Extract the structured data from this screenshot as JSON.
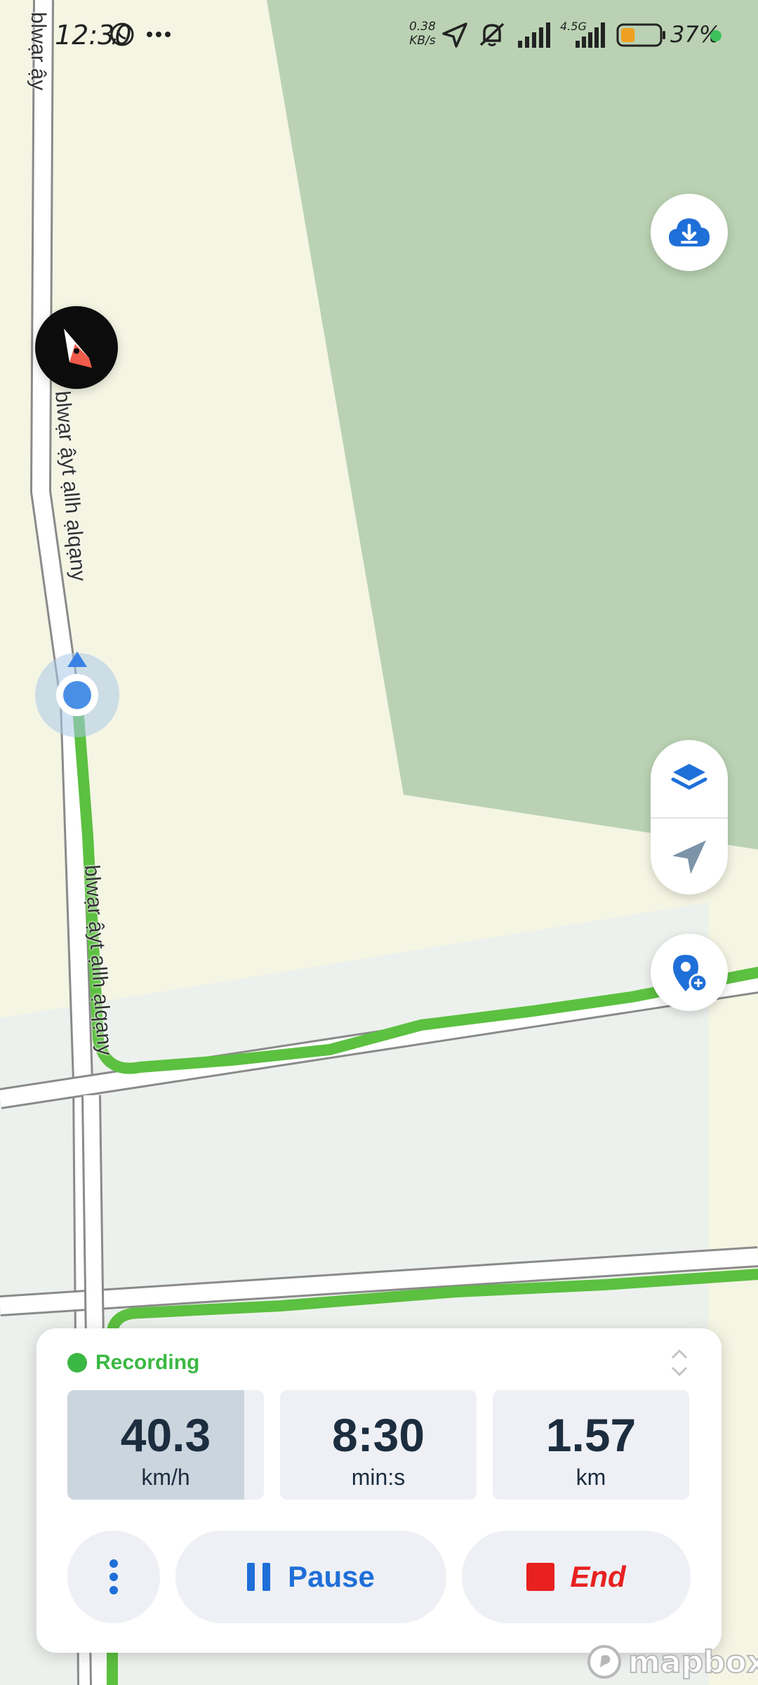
{
  "status_bar": {
    "time": "12:30",
    "network_speed_value": "0.38",
    "network_speed_unit": "KB/s",
    "network_type": "4.5G",
    "battery_percent": "37%",
    "battery_level": 0.37,
    "icons": [
      "whatsapp-icon",
      "more-dots-icon",
      "location-arrow-icon",
      "mute-bell-icon",
      "signal-icon",
      "signal-4g-icon",
      "battery-icon"
    ]
  },
  "map": {
    "road_labels": [
      "blwạr ậyt ạllh ạlqạny",
      "blwạr ậyt ạllh ạlqạny",
      "blwạr ậy"
    ],
    "route_color": "#5cc040",
    "park_color": "#bad2b3",
    "land_color": "#f5f5e4"
  },
  "controls": {
    "download_icon": "cloud-download-icon",
    "compass_icon": "compass-icon",
    "layers_icon": "layers-icon",
    "locate_icon": "navigation-arrow-icon",
    "add_pin_icon": "add-pin-icon"
  },
  "recording": {
    "status_label": "Recording",
    "status_color": "#3bb843",
    "stats": [
      {
        "value": "40.3",
        "unit": "km/h"
      },
      {
        "value": "8:30",
        "unit": "min:s"
      },
      {
        "value": "1.57",
        "unit": "km"
      }
    ],
    "speed_fill_fraction": 0.9,
    "pause_label": "Pause",
    "end_label": "End",
    "accent_color": "#1f6fd8",
    "end_color": "#e82020"
  },
  "attribution": {
    "logo_text": "mapbox"
  }
}
